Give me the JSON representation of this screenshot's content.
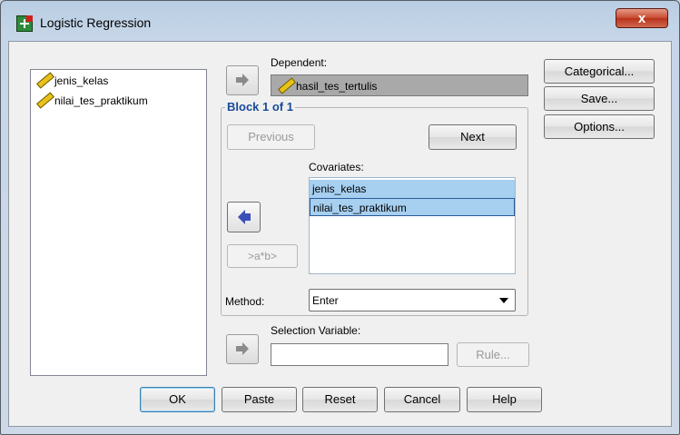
{
  "window": {
    "title": "Logistic Regression",
    "close_label": "x"
  },
  "variables": {
    "items": [
      {
        "label": "jenis_kelas",
        "icon": "scale-ruler-icon"
      },
      {
        "label": "nilai_tes_praktikum",
        "icon": "scale-ruler-icon"
      }
    ]
  },
  "dependent": {
    "label": "Dependent:",
    "value": "hasil_tes_tertulis"
  },
  "block": {
    "title": "Block 1 of 1",
    "previous_label": "Previous",
    "next_label": "Next"
  },
  "covariates": {
    "label": "Covariates:",
    "items": [
      "jenis_kelas",
      "nilai_tes_praktikum"
    ],
    "interaction_label": ">a*b>"
  },
  "method": {
    "label": "Method:",
    "value": "Enter"
  },
  "selection": {
    "label": "Selection Variable:",
    "value": "",
    "rule_label": "Rule..."
  },
  "side_buttons": {
    "categorical": "Categorical...",
    "save": "Save...",
    "options": "Options..."
  },
  "bottom_buttons": {
    "ok": "OK",
    "paste": "Paste",
    "reset": "Reset",
    "cancel": "Cancel",
    "help": "Help"
  },
  "colors": {
    "group_title": "#1a4a9a",
    "selection_highlight": "#a6cff0",
    "close_button": "#c8492f"
  }
}
